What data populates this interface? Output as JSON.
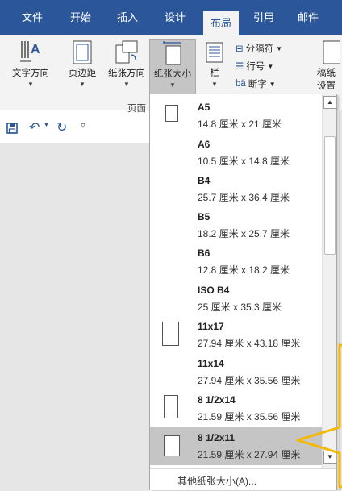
{
  "tabs": [
    "文件",
    "开始",
    "插入",
    "设计",
    "布局",
    "引用",
    "邮件"
  ],
  "ribbon": {
    "text_direction": "文字方向",
    "margins": "页边距",
    "orientation": "纸张方向",
    "size": "纸张大小",
    "columns": "栏",
    "breaks": "分隔符",
    "line_numbers": "行号",
    "hyphenation": "断字",
    "draft_settings_line1": "稿纸",
    "draft_settings_line2": "设置",
    "group_label": "页面"
  },
  "paper_sizes": [
    {
      "name": "A5",
      "dims": "14.8 厘米 x 21 厘米"
    },
    {
      "name": "A6",
      "dims": "10.5 厘米 x 14.8 厘米"
    },
    {
      "name": "B4",
      "dims": "25.7 厘米 x 36.4 厘米"
    },
    {
      "name": "B5",
      "dims": "18.2 厘米 x 25.7 厘米"
    },
    {
      "name": "B6",
      "dims": "12.8 厘米 x 18.2 厘米"
    },
    {
      "name": "ISO B4",
      "dims": "25 厘米 x 35.3 厘米"
    },
    {
      "name": "11x17",
      "dims": "27.94 厘米 x 43.18 厘米"
    },
    {
      "name": "11x14",
      "dims": "27.94 厘米 x 35.56 厘米"
    },
    {
      "name": "8 1/2x14",
      "dims": "21.59 厘米 x 35.56 厘米"
    },
    {
      "name": "8 1/2x11",
      "dims": "21.59 厘米 x 27.94 厘米"
    }
  ],
  "selected_size": "8 1/2x11",
  "more_sizes": "其他纸张大小(A)...",
  "colors": {
    "tab_bar": "#2b579a",
    "selected": "#c5c5c5",
    "highlight_arrow": "#f5b800",
    "qat_icons": "#2b579a"
  }
}
